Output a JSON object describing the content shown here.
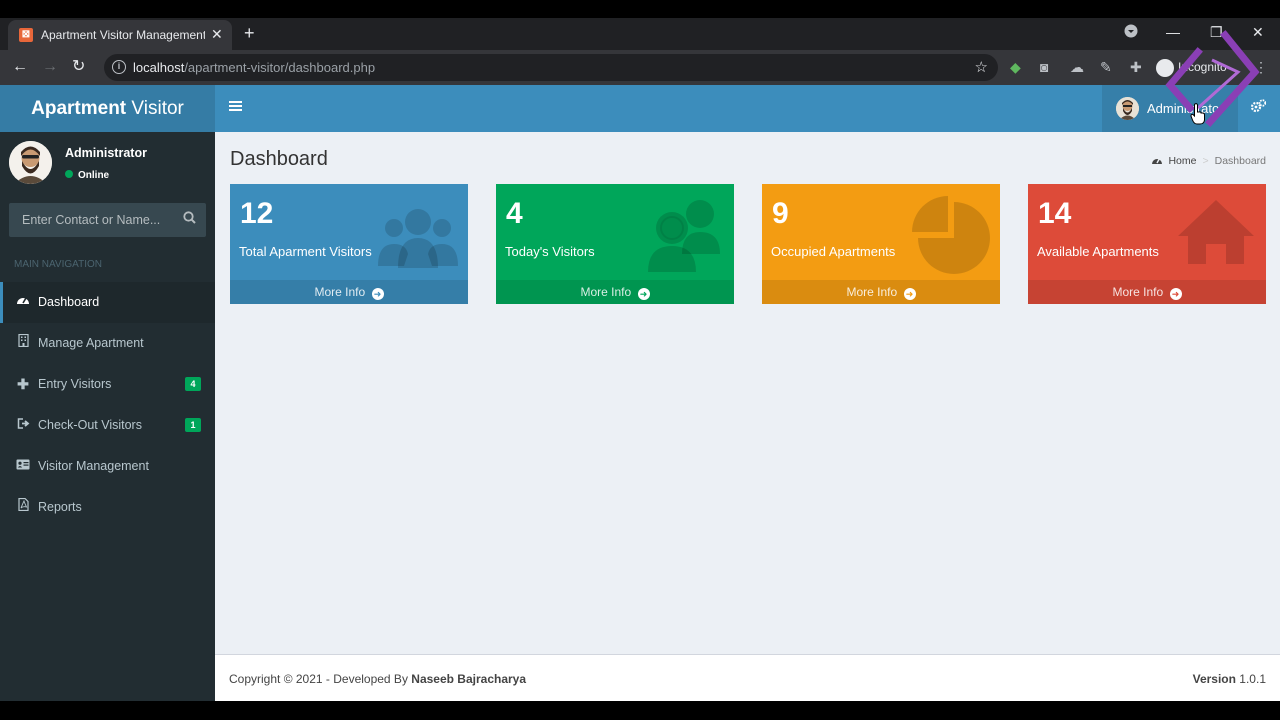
{
  "browser": {
    "tab_title": "Apartment Visitor Management S",
    "url_host": "localhost",
    "url_path": "/apartment-visitor/dashboard.php",
    "incognito_label": "Incognito"
  },
  "app": {
    "logo_bold": "Apartment",
    "logo_rest": " Visitor",
    "topnav_user": "Administrator"
  },
  "sidebar": {
    "user_name": "Administrator",
    "user_status": "Online",
    "search_placeholder": "Enter Contact or Name...",
    "nav_header": "MAIN NAVIGATION",
    "items": [
      {
        "label": "Dashboard",
        "icon": "dashboard-icon"
      },
      {
        "label": "Manage Apartment",
        "icon": "building-icon"
      },
      {
        "label": "Entry Visitors",
        "icon": "plus-icon",
        "badge": "4"
      },
      {
        "label": "Check-Out Visitors",
        "icon": "sign-out-icon",
        "badge": "1"
      },
      {
        "label": "Visitor Management",
        "icon": "id-card-icon"
      },
      {
        "label": "Reports",
        "icon": "file-pdf-icon"
      }
    ]
  },
  "main": {
    "title": "Dashboard",
    "breadcrumb_home": "Home",
    "breadcrumb_current": "Dashboard",
    "boxes": [
      {
        "value": "12",
        "label": "Total Aparment Visitors",
        "more": "More Info",
        "color": "#3c8dbc",
        "icon": "users-icon"
      },
      {
        "value": "4",
        "label": "Today's Visitors",
        "more": "More Info",
        "color": "#00a65a",
        "icon": "user-group-icon"
      },
      {
        "value": "9",
        "label": "Occupied Apartments",
        "more": "More Info",
        "color": "#f39c12",
        "icon": "pie-chart-icon"
      },
      {
        "value": "14",
        "label": "Available Apartments",
        "more": "More Info",
        "color": "#dd4b39",
        "icon": "home-icon"
      }
    ]
  },
  "footer": {
    "copyright": "Copyright © 2021 - Developed By ",
    "author": "Naseeb Bajracharya",
    "version_label": "Version",
    "version": " 1.0.1"
  }
}
